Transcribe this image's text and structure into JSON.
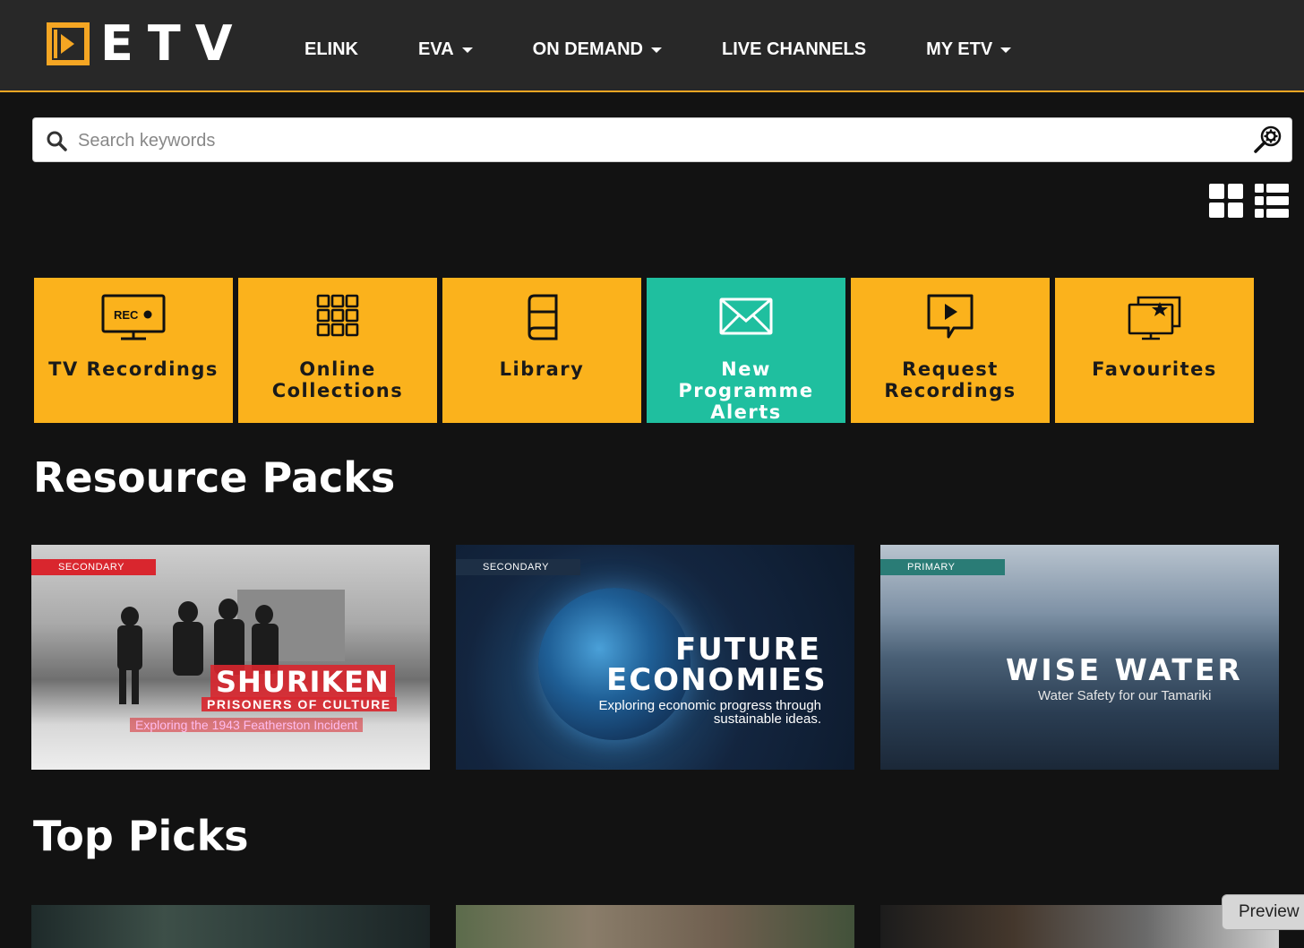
{
  "header": {
    "logo_text": "ETV",
    "nav": [
      {
        "label": "ELINK",
        "dropdown": false
      },
      {
        "label": "EVA",
        "dropdown": true
      },
      {
        "label": "ON DEMAND",
        "dropdown": true
      },
      {
        "label": "LIVE CHANNELS",
        "dropdown": false
      },
      {
        "label": "MY ETV",
        "dropdown": true
      }
    ]
  },
  "search": {
    "placeholder": "Search keywords",
    "value": ""
  },
  "view_toggle": {
    "icons": [
      "grid-view-icon",
      "list-view-icon"
    ]
  },
  "tiles": [
    {
      "label": "TV Recordings",
      "icon": "tv-rec-icon",
      "color": "#fbb21c",
      "rec_text": "REC"
    },
    {
      "label": "Online Collections",
      "icon": "grid-collection-icon",
      "color": "#fbb21c"
    },
    {
      "label": "Library",
      "icon": "book-icon",
      "color": "#fbb21c"
    },
    {
      "label": "New Programme Alerts",
      "icon": "envelope-icon",
      "color": "#1fbf9f"
    },
    {
      "label": "Request Recordings",
      "icon": "play-speech-icon",
      "color": "#fbb21c"
    },
    {
      "label": "Favourites",
      "icon": "star-screen-icon",
      "color": "#fbb21c"
    }
  ],
  "sections": {
    "resource_packs": "Resource Packs",
    "top_picks": "Top Picks"
  },
  "resource_packs": [
    {
      "badge": "SECONDARY",
      "badge_color": "#d9262e",
      "title": "SHURIKEN",
      "subtitle": "PRISONERS OF CULTURE",
      "tagline": "Exploring the 1943 Featherston Incident"
    },
    {
      "badge": "SECONDARY",
      "badge_color": "#1d2f45",
      "title_line1": "FUTURE",
      "title_line2": "ECONOMIES",
      "tagline_line1": "Exploring economic progress through",
      "tagline_line2": "sustainable ideas."
    },
    {
      "badge": "PRIMARY",
      "badge_color": "#2a7c76",
      "title": "WISE WATER",
      "tagline": "Water Safety for our Tamariki"
    }
  ],
  "preview_button": "Preview"
}
